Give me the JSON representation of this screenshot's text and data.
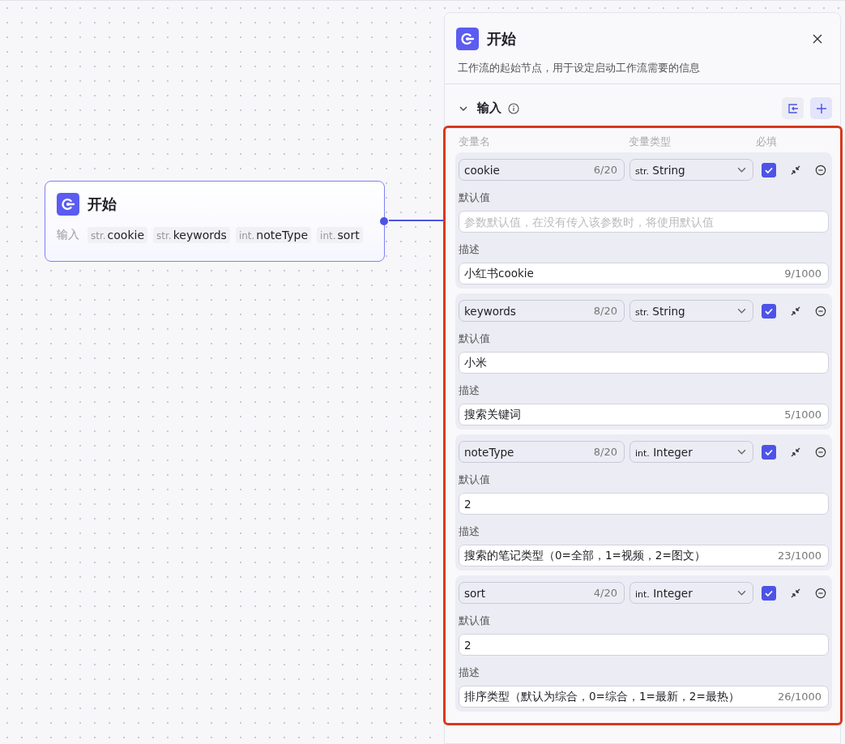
{
  "node": {
    "title": "开始",
    "inputs_label": "输入",
    "inputs": [
      {
        "type": "str.",
        "name": "cookie"
      },
      {
        "type": "str.",
        "name": "keywords"
      },
      {
        "type": "int.",
        "name": "noteType"
      },
      {
        "type": "int.",
        "name": "sort"
      }
    ]
  },
  "panel": {
    "title": "开始",
    "description": "工作流的起始节点，用于设定启动工作流需要的信息",
    "section": {
      "title": "输入",
      "expanded": true
    },
    "columns": [
      "变量名",
      "变量类型",
      "必填"
    ],
    "variables": [
      {
        "name": "cookie",
        "name_count": "6/20",
        "type_prefix": "str.",
        "type": "String",
        "required": true,
        "default_label": "默认值",
        "default": {
          "placeholder": "参数默认值，在没有传入该参数时，将使用默认值"
        },
        "desc_label": "描述",
        "description": "小红书cookie",
        "desc_count": "9/1000"
      },
      {
        "name": "keywords",
        "name_count": "8/20",
        "type_prefix": "str.",
        "type": "String",
        "required": true,
        "default_label": "默认值",
        "default": {
          "value": "小米"
        },
        "desc_label": "描述",
        "description": "搜索关键词",
        "desc_count": "5/1000"
      },
      {
        "name": "noteType",
        "name_count": "8/20",
        "type_prefix": "int.",
        "type": "Integer",
        "required": true,
        "default_label": "默认值",
        "default": {
          "value": "2"
        },
        "desc_label": "描述",
        "description": "搜索的笔记类型（0=全部，1=视频，2=图文）",
        "desc_count": "23/1000"
      },
      {
        "name": "sort",
        "name_count": "4/20",
        "type_prefix": "int.",
        "type": "Integer",
        "required": true,
        "default_label": "默认值",
        "default": {
          "value": "2"
        },
        "desc_label": "描述",
        "description": "排序类型（默认为综合，0=综合，1=最新，2=最热）",
        "desc_count": "26/1000"
      }
    ]
  }
}
